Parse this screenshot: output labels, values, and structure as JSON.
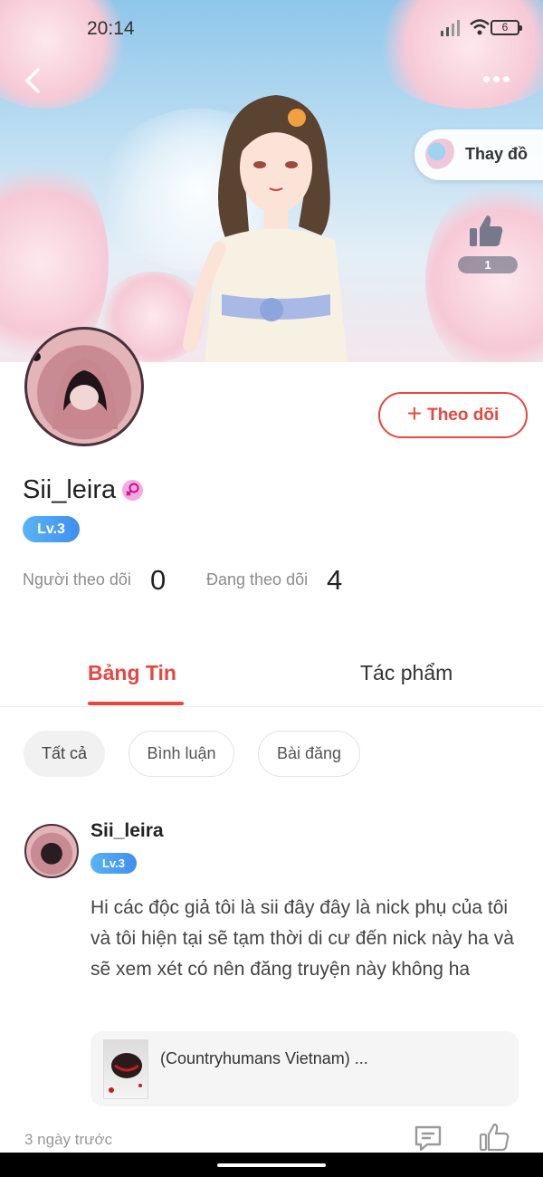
{
  "status_bar": {
    "time": "20:14",
    "battery": "6"
  },
  "header": {
    "outfit_button_label": "Thay đồ",
    "like_count": "1"
  },
  "profile": {
    "username": "Sii_leira",
    "level": "Lv.3",
    "follow_button": "Theo dõi",
    "followers_label": "Người theo dõi",
    "followers_count": "0",
    "following_label": "Đang theo dõi",
    "following_count": "4"
  },
  "tabs": [
    {
      "label": "Bảng Tin",
      "active": true
    },
    {
      "label": "Tác phẩm",
      "active": false
    }
  ],
  "filters": [
    {
      "label": "Tất cả",
      "active": true
    },
    {
      "label": "Bình luận",
      "active": false
    },
    {
      "label": "Bài đăng",
      "active": false
    }
  ],
  "post": {
    "author": "Sii_leira",
    "level": "Lv.3",
    "text": "Hi các độc giả tôi là sii đây đây là nick phụ của tôi và tôi hiện tại sẽ tạm thời di cư đến nick này ha và sẽ xem xét có nên đăng truyện này không ha",
    "linked_story": "(Countryhumans Vietnam) ...",
    "time": "3 ngày trước"
  },
  "colors": {
    "accent": "#e8463f",
    "level_badge": "#4fa3f2"
  },
  "icons": [
    "back-icon",
    "more-icon",
    "signal-icon",
    "wifi-icon",
    "battery-icon",
    "thumbs-up-icon",
    "plus-icon",
    "female-icon",
    "comment-icon"
  ]
}
